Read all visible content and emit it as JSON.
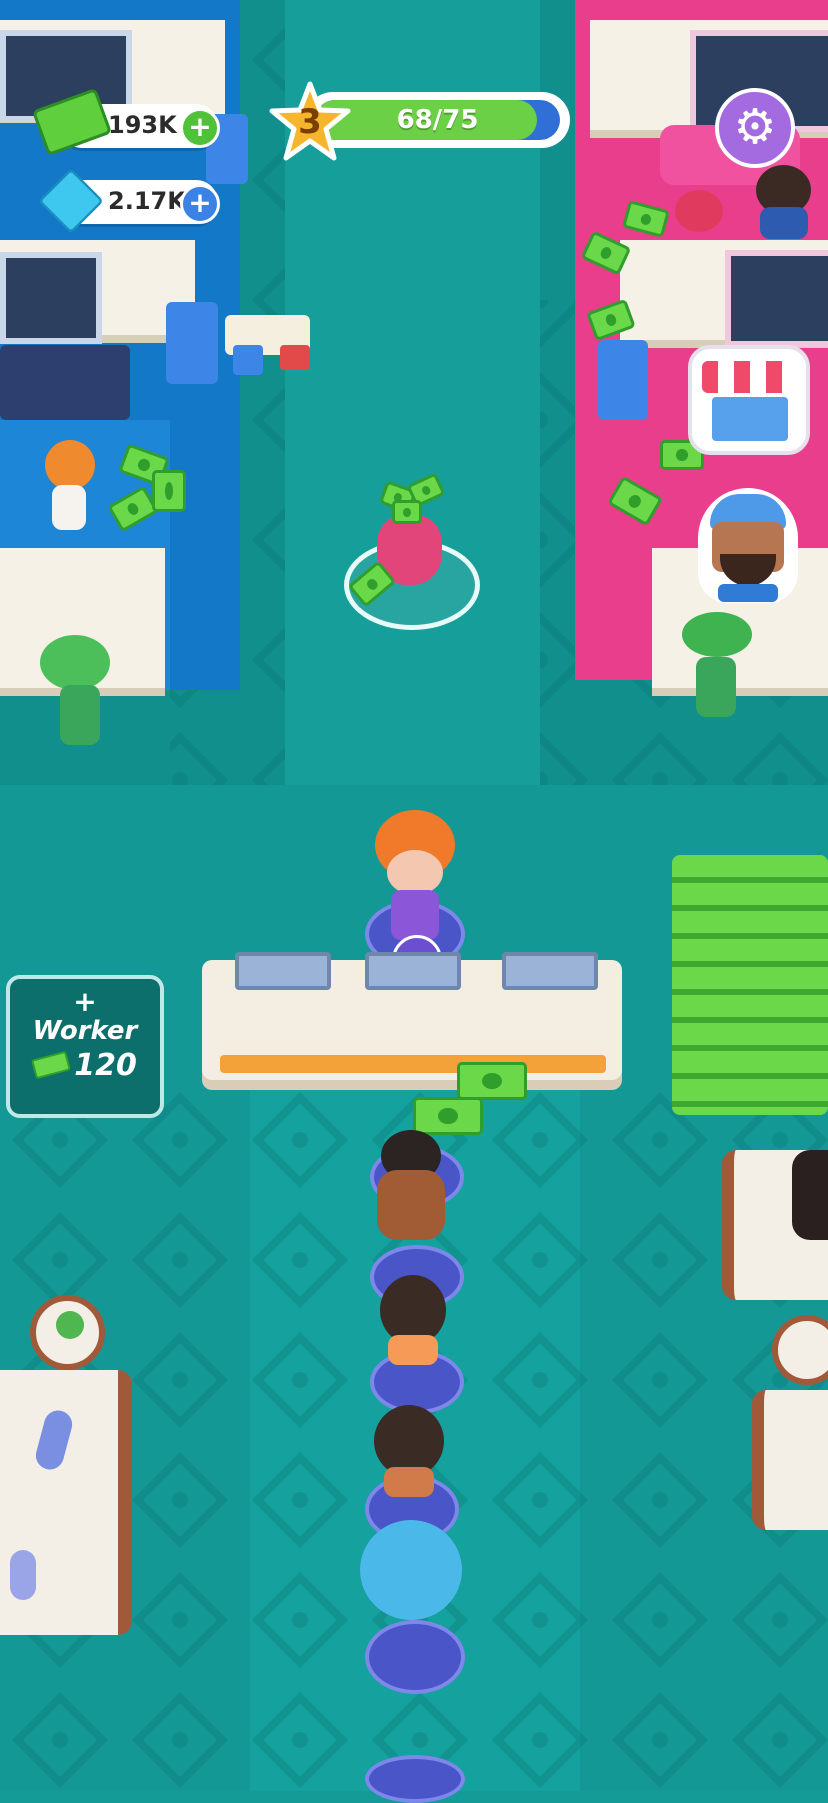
{
  "hud": {
    "cash": {
      "value": "193K",
      "icon": "cash-icon",
      "plus": "+"
    },
    "gems": {
      "value": "2.17K",
      "icon": "diamond-icon",
      "plus": "+"
    },
    "level": {
      "value": "3",
      "icon": "star-icon"
    },
    "xp": {
      "text": "68/75",
      "fraction": 0.9067
    },
    "settings": {
      "icon": "gear-icon",
      "glyph": "⚙"
    }
  },
  "worker_button": {
    "title": "Worker",
    "cost": "120",
    "icon": "add-worker-icon",
    "glyph": "+"
  },
  "colors": {
    "floor": "#139896",
    "corridor": "#169e9a",
    "left_salon": "#1478c8",
    "right_salon": "#e83e8c",
    "cash_green": "#6bd84a",
    "xp_fill": "#6cd046",
    "gear_purple": "#a46ae0"
  },
  "icons": [
    "cash-icon",
    "diamond-icon",
    "star-icon",
    "gear-icon",
    "shop-icon",
    "add-worker-icon",
    "cash-register-icon",
    "money-bag-icon",
    "worker-portrait-icon"
  ]
}
